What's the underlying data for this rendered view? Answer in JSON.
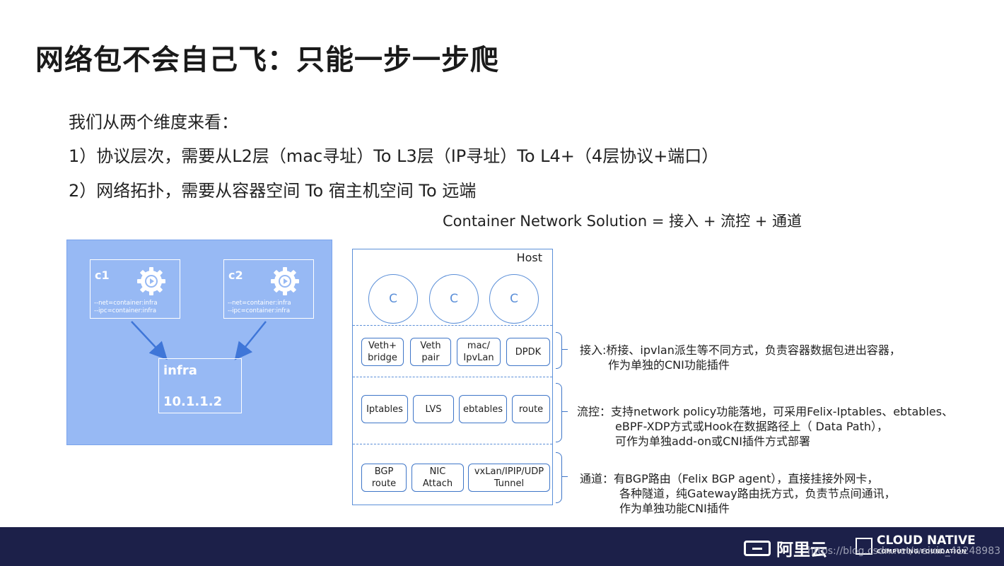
{
  "slide": {
    "title": "网络包不会自己飞：只能一步一步爬",
    "intro": "我们从两个维度来看：",
    "point1": "1）协议层次，需要从L2层（mac寻址）To  L3层（IP寻址）To  L4+（4层协议+端口）",
    "point2": "2）网络拓扑，需要从容器空间  To  宿主机空间  To 远端",
    "formula": "Container Network Solution = 接入 + 流控 + 通道"
  },
  "pod_diagram": {
    "containers": [
      {
        "name": "c1",
        "flags": [
          "--net=container:infra",
          "--ipc=container:infra"
        ]
      },
      {
        "name": "c2",
        "flags": [
          "--net=container:infra",
          "--ipc=container:infra"
        ]
      }
    ],
    "infra": {
      "name": "infra",
      "ip": "10.1.1.2"
    },
    "colors": {
      "background": "#97b9f4",
      "arrow": "#3f76d8"
    }
  },
  "host_diagram": {
    "label": "Host",
    "containers": [
      "C",
      "C",
      "C"
    ],
    "access_row": [
      "Veth+\nbridge",
      "Veth\npair",
      "mac/\nIpvLan",
      "DPDK"
    ],
    "flow_row": [
      "Iptables",
      "LVS",
      "ebtables",
      "route"
    ],
    "channel_row": [
      "BGP\nroute",
      "NIC\nAttach",
      "vxLan/IPIP/UDP\nTunnel"
    ]
  },
  "notes": {
    "access": [
      "接入:桥接、ipvlan派生等不同方式，负责容器数据包进出容器，",
      "作为单独的CNI功能插件"
    ],
    "flow": [
      "流控：支持network policy功能落地，可采用Felix-Iptables、ebtables、",
      "eBPF-XDP方式或Hook在数据路径上（ Data Path），",
      "可作为单独add-on或CNI插件方式部署"
    ],
    "channel": [
      "通道：有BGP路由（Felix BGP agent），直接挂接外网卡，",
      "各种隧道，纯Gateway路由抚方式，负责节点间通讯，",
      "作为单独功能CNI插件"
    ]
  },
  "footer": {
    "aliyun": "阿里云",
    "cncf_main": "CLOUD NATIVE",
    "cncf_sub": "COMPUTING FOUNDATION",
    "watermark": "https://blog.csdn.net/weixin_41248983",
    "background": "#1c2049"
  }
}
